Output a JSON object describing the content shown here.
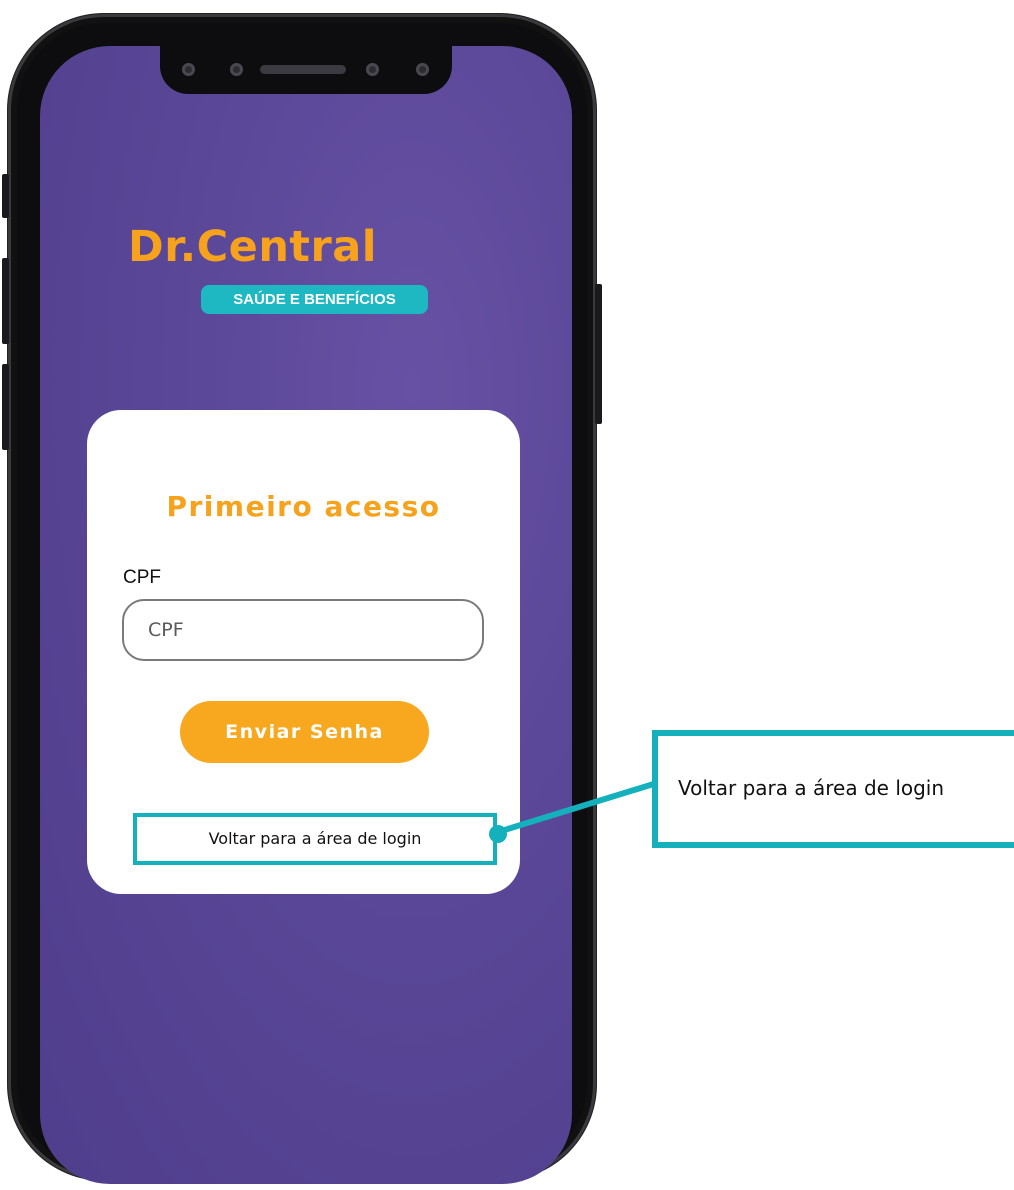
{
  "app": {
    "logo_title": "Dr.Central",
    "logo_subtitle": "SAÚDE E BENEFÍCIOS"
  },
  "form": {
    "title": "Primeiro acesso",
    "cpf_label": "CPF",
    "cpf_placeholder": "CPF",
    "cpf_value": "",
    "submit_label": "Enviar Senha",
    "back_link_label": "Voltar para a área de login"
  },
  "annotation": {
    "callout_text": "Voltar para a área de login"
  },
  "colors": {
    "brand_orange": "#f6a21d",
    "brand_teal": "#1eb8c2",
    "background_purple": "#5a4797",
    "highlight_teal": "#14b1bd"
  }
}
